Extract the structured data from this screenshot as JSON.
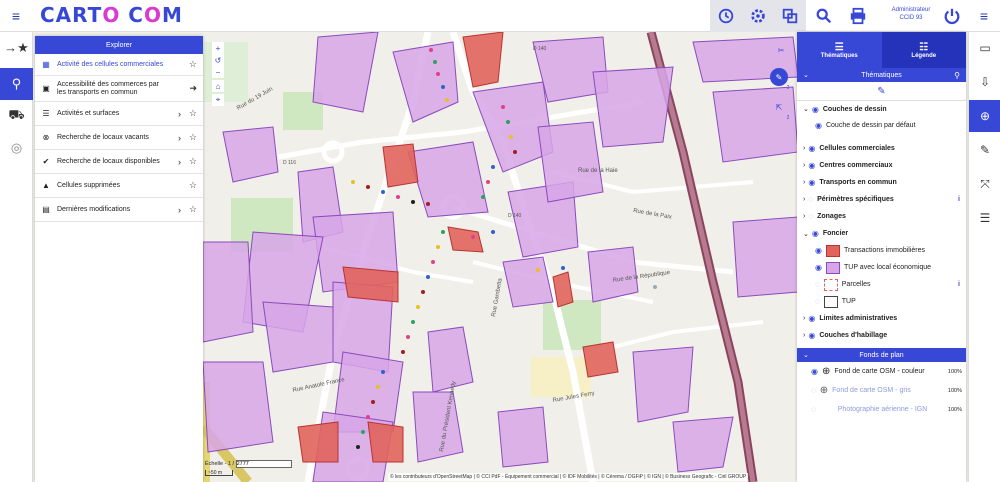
{
  "brand": {
    "logo_left": "CART",
    "logo_mid": "O",
    "logo_c": "C",
    "logo_o": "O",
    "logo_right": "M"
  },
  "user": {
    "role": "Administrateur",
    "org": "CCID 93"
  },
  "colors": {
    "accent": "#3848d6",
    "tup_fill": "#d7a6e8",
    "tup_stroke": "#8b4bbd",
    "transaction_fill": "#e0645c"
  },
  "toolbar": {
    "history_icon": "history-icon",
    "settings_icon": "gear-icon",
    "layers_icon": "layers-icon",
    "search_icon": "search-icon",
    "print_icon": "print-icon",
    "power_icon": "power-icon"
  },
  "explorer": {
    "title": "Explorer",
    "items": [
      {
        "label": "Activité des cellules commerciales",
        "icon": "grid-icon",
        "action": "none"
      },
      {
        "label": "Accessibilité des commerces par les transports en commun",
        "icon": "train-icon",
        "action": "arrow"
      },
      {
        "label": "Activités et surfaces",
        "icon": "list-icon",
        "action": "chevron"
      },
      {
        "label": "Recherche de locaux vacants",
        "icon": "close-circle-icon",
        "action": "chevron"
      },
      {
        "label": "Recherche de locaux disponibles",
        "icon": "check-circle-icon",
        "action": "chevron"
      },
      {
        "label": "Cellules supprimées",
        "icon": "cone-icon",
        "action": "none"
      },
      {
        "label": "Dernières modifications",
        "icon": "calendar-icon",
        "action": "chevron"
      }
    ]
  },
  "right_panel": {
    "tabs": [
      "Thématiques",
      "Légende"
    ],
    "section_title": "Thématiques",
    "drawing_group": "Couches de dessin",
    "drawing_default": "Couche de dessin par défaut",
    "groups": [
      "Cellules commerciales",
      "Centres commerciaux",
      "Transports en commun",
      "Périmètres spécifiques",
      "Zonages",
      "Foncier"
    ],
    "foncier_items": [
      "Transactions immobilières",
      "TUP avec local économique",
      "Parcelles",
      "TUP"
    ],
    "groups_after": [
      "Limites administratives",
      "Couches d'habillage"
    ],
    "basemap_title": "Fonds de plan",
    "basemaps": [
      {
        "label": "Fond de carte OSM - couleur",
        "pct": "100%",
        "active": true
      },
      {
        "label": "Fond de carte OSM - gris",
        "pct": "100%",
        "active": false
      },
      {
        "label": "Photographie aérienne - IGN",
        "pct": "100%",
        "active": false
      }
    ]
  },
  "map": {
    "scale_label": "Échelle - 1 /",
    "scale_value": "2777",
    "scale_bar": "~50 m",
    "badge_count": "2",
    "attribution": "© les contributeurs d'OpenStreetMap | © CCI PdF - Équipement commercial | © IDF Mobilités | © Cérema / DGFiP | © IGN | © Business Geografic - Ciril GROUP",
    "street_labels": [
      "Rue du 19 Juin",
      "Rue de la Haie",
      "Rue de la Paix",
      "Rue de la République",
      "Rue Anatole France",
      "Rue Jules Ferry",
      "Rue du Président Kennedy",
      "Rue Gambetta"
    ],
    "road_numbers": [
      "D 140",
      "D 116",
      "D 140"
    ]
  }
}
